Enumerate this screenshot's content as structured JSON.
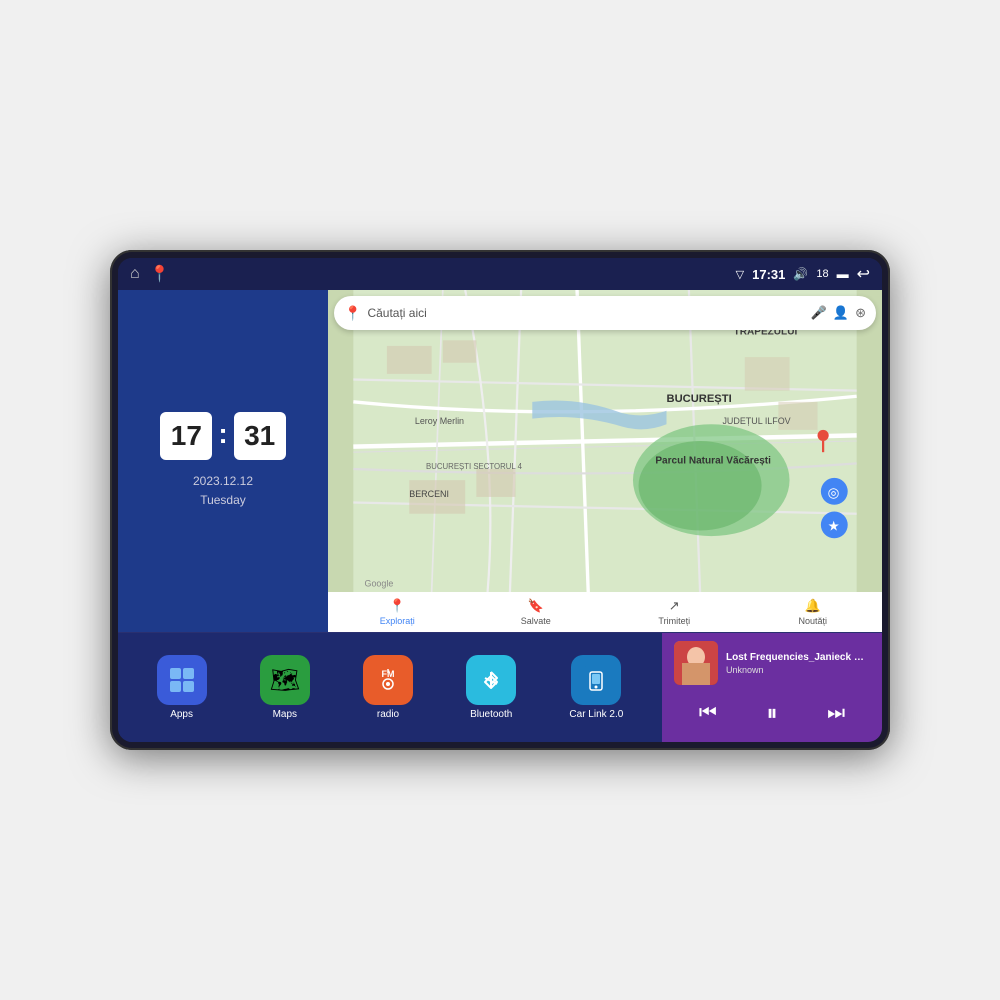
{
  "device": {
    "status_bar": {
      "time": "17:31",
      "signal_icon": "▽",
      "volume_icon": "🔊",
      "battery_level": "18",
      "battery_icon": "🔋",
      "back_icon": "↩",
      "home_icon": "⌂",
      "maps_icon": "📍"
    },
    "clock": {
      "hour": "17",
      "minute": "31",
      "date": "2023.12.12",
      "day": "Tuesday"
    },
    "map": {
      "search_placeholder": "Căutați aici",
      "nav_items": [
        {
          "label": "Explorați",
          "icon": "📍",
          "active": true
        },
        {
          "label": "Salvate",
          "icon": "🔖",
          "active": false
        },
        {
          "label": "Trimiteți",
          "icon": "↗",
          "active": false
        },
        {
          "label": "Noutăți",
          "icon": "🔔",
          "active": false
        }
      ],
      "labels": [
        "TRAPEZULUI",
        "BUCUREȘTI",
        "JUDEȚUL ILFOV",
        "Parcul Natural Văcărești",
        "Leroy Merlin",
        "BUCUREȘTI SECTORUL 4",
        "BERCENI",
        "Google"
      ]
    },
    "apps": [
      {
        "label": "Apps",
        "icon": "⊞",
        "bg_color": "#3a5bd9"
      },
      {
        "label": "Maps",
        "icon": "🗺",
        "bg_color": "#2a9d3f"
      },
      {
        "label": "radio",
        "icon": "📻",
        "bg_color": "#e85c2a"
      },
      {
        "label": "Bluetooth",
        "icon": "⚡",
        "bg_color": "#2abbdf"
      },
      {
        "label": "Car Link 2.0",
        "icon": "📱",
        "bg_color": "#1a7abf"
      }
    ],
    "music": {
      "title": "Lost Frequencies_Janieck Devy-...",
      "artist": "Unknown",
      "controls": {
        "prev": "⏮",
        "play": "⏸",
        "next": "⏭"
      }
    }
  }
}
